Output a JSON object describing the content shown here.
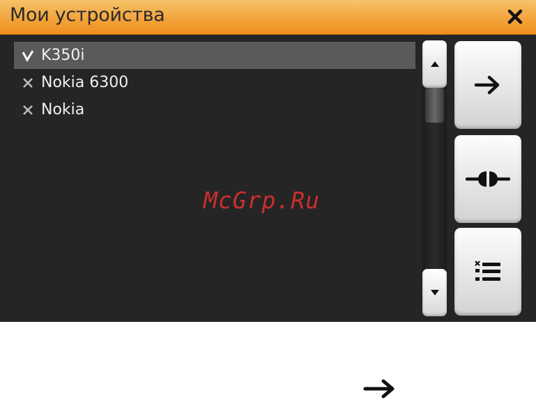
{
  "window": {
    "title": "Мои устройства",
    "close_icon": "close-icon"
  },
  "devices": [
    {
      "name": "K350i",
      "status": "connected",
      "icon": "checkmark-icon",
      "selected": true
    },
    {
      "name": "Nokia 6300",
      "status": "disconnected",
      "icon": "cross-icon",
      "selected": false
    },
    {
      "name": "Nokia",
      "status": "disconnected",
      "icon": "cross-icon",
      "selected": false
    }
  ],
  "scrollbar": {
    "up_icon": "triangle-up-icon",
    "down_icon": "triangle-down-icon"
  },
  "side_buttons": [
    {
      "name": "send-button",
      "icon": "arrow-right-icon"
    },
    {
      "name": "connect-button",
      "icon": "plug-connect-icon"
    },
    {
      "name": "delete-list-button",
      "icon": "delete-list-icon"
    }
  ],
  "watermark": "McGrp.Ru",
  "annotation_icon": "arrow-right-icon",
  "colors": {
    "titlebar": "#f3a43c",
    "background": "#252525",
    "selected_row": "#5a5a5a",
    "text": "#f0f0f0",
    "watermark": "#e03030"
  }
}
